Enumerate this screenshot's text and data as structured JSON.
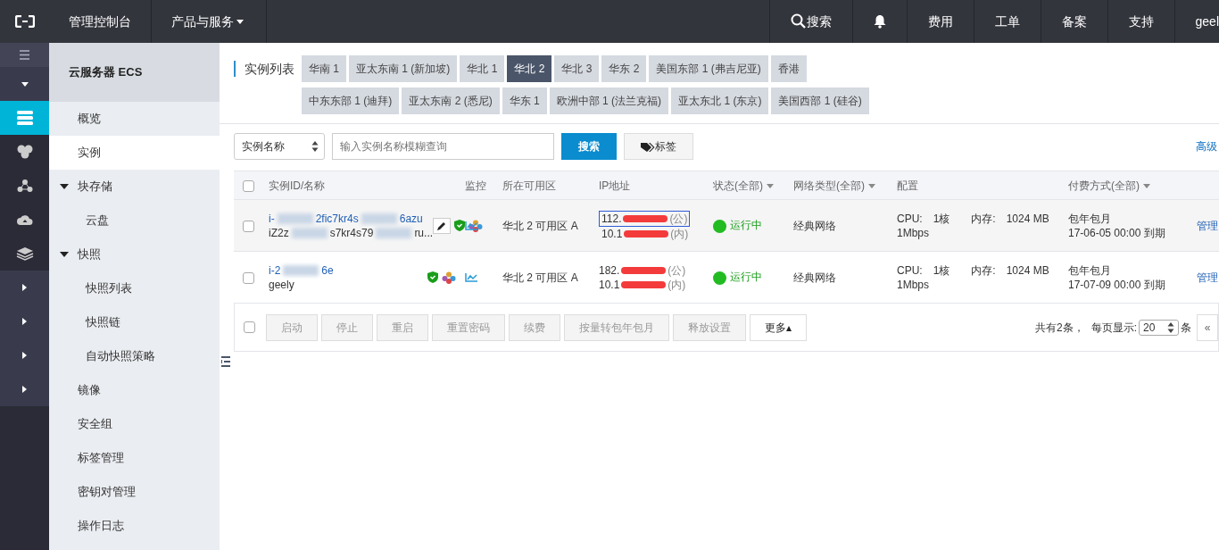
{
  "topbar": {
    "console": "管理控制台",
    "products": "产品与服务",
    "search": "搜索",
    "links": [
      "费用",
      "工单",
      "备案",
      "支持"
    ],
    "user": "geel"
  },
  "rail": [
    {
      "kind": "menu"
    },
    {
      "kind": "caret-down"
    },
    {
      "kind": "server",
      "selected": true
    },
    {
      "kind": "cluster",
      "selected": false
    },
    {
      "kind": "network",
      "selected": false
    },
    {
      "kind": "cloud",
      "selected": false
    },
    {
      "kind": "layers",
      "selected": false
    },
    {
      "kind": "caret-right"
    },
    {
      "kind": "caret-right"
    },
    {
      "kind": "caret-right"
    },
    {
      "kind": "caret-right"
    }
  ],
  "sidebar": {
    "title": "云服务器 ECS",
    "items": [
      {
        "label": "概览",
        "selected": false
      },
      {
        "label": "实例",
        "selected": true
      },
      {
        "label": "块存储",
        "selected": false,
        "expanded": true,
        "children": [
          {
            "label": "云盘",
            "selected": false
          }
        ]
      },
      {
        "label": "快照",
        "selected": false,
        "expanded": true,
        "children": [
          {
            "label": "快照列表",
            "selected": false
          },
          {
            "label": "快照链",
            "selected": false
          },
          {
            "label": "自动快照策略",
            "selected": false
          }
        ]
      },
      {
        "label": "镜像",
        "selected": false
      },
      {
        "label": "安全组",
        "selected": false
      },
      {
        "label": "标签管理",
        "selected": false
      },
      {
        "label": "密钥对管理",
        "selected": false
      },
      {
        "label": "操作日志",
        "selected": false
      }
    ]
  },
  "page_title": "实例列表",
  "regions": [
    [
      {
        "label": "华南 1",
        "selected": false
      },
      {
        "label": "亚太东南 1 (新加坡)",
        "selected": false
      },
      {
        "label": "华北 1",
        "selected": false
      },
      {
        "label": "华北 2",
        "selected": true
      },
      {
        "label": "华北 3",
        "selected": false
      },
      {
        "label": "华东 2",
        "selected": false
      },
      {
        "label": "美国东部 1 (弗吉尼亚)",
        "selected": false
      },
      {
        "label": "香港",
        "selected": false
      }
    ],
    [
      {
        "label": "中东东部 1 (迪拜)",
        "selected": false
      },
      {
        "label": "亚太东南 2 (悉尼)",
        "selected": false
      },
      {
        "label": "华东 1",
        "selected": false
      },
      {
        "label": "欧洲中部 1 (法兰克福)",
        "selected": false
      },
      {
        "label": "亚太东北 1 (东京)",
        "selected": false
      },
      {
        "label": "美国西部 1 (硅谷)",
        "selected": false
      }
    ]
  ],
  "filter": {
    "select": "实例名称",
    "placeholder": "输入实例名称模糊查询",
    "search_button": "搜索",
    "tag_button": "标签",
    "advanced": "高级"
  },
  "table": {
    "all_checked": false,
    "columns": [
      "实例ID/名称",
      "监控",
      "所在可用区",
      "IP地址",
      "状态(全部)",
      "网络类型(全部)",
      "配置",
      "付费方式(全部)"
    ],
    "rows": [
      {
        "checked": false,
        "id_parts": [
          "i-",
          "2fic7kr4s",
          "6azu"
        ],
        "name_parts": [
          "iZ2z",
          "s7kr4s79",
          "ru..."
        ],
        "edit_shown": true,
        "zone": "华北 2 可用区 A",
        "public_ip": "112.",
        "public_tag": "(公)",
        "ip_selected": true,
        "private_ip": "10.1",
        "private_tag": "(内)",
        "status": "运行中",
        "network": "经典网络",
        "cpu": "CPU:　1核",
        "memory": "内存:　1024 MB",
        "bandwidth": "1Mbps",
        "billing": "包年包月",
        "expiry": "17-06-05 00:00 到期",
        "action": "管理"
      },
      {
        "checked": false,
        "id_parts": [
          "i-2",
          "6e"
        ],
        "name_parts": [
          "geely"
        ],
        "edit_shown": false,
        "zone": "华北 2 可用区 A",
        "public_ip": "182.",
        "public_tag": "(公)",
        "ip_selected": false,
        "private_ip": "10.1",
        "private_tag": "(内)",
        "status": "运行中",
        "network": "经典网络",
        "cpu": "CPU:　1核",
        "memory": "内存:　1024 MB",
        "bandwidth": "1Mbps",
        "billing": "包年包月",
        "expiry": "17-07-09 00:00 到期",
        "action": "管理"
      }
    ]
  },
  "footer": {
    "checked": false,
    "actions": [
      {
        "label": "启动",
        "disabled": true
      },
      {
        "label": "停止",
        "disabled": true
      },
      {
        "label": "重启",
        "disabled": true
      },
      {
        "label": "重置密码",
        "disabled": true
      },
      {
        "label": "续费",
        "disabled": true
      },
      {
        "label": "按量转包年包月",
        "disabled": true
      },
      {
        "label": "释放设置",
        "disabled": true
      },
      {
        "label": "更多▴",
        "disabled": false
      }
    ],
    "total": "共有2条，",
    "per_page_label": "每页显示:",
    "per_page": "20",
    "unit": "条",
    "prev": "«"
  }
}
